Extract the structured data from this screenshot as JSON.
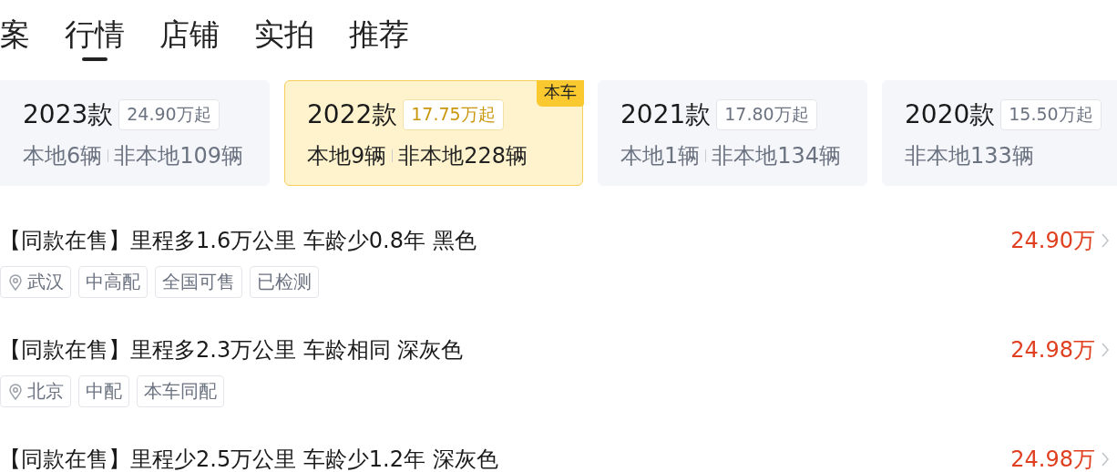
{
  "tabs": [
    {
      "label": "案",
      "selected": false
    },
    {
      "label": "行情",
      "selected": true
    },
    {
      "label": "店铺",
      "selected": false
    },
    {
      "label": "实拍",
      "selected": false
    },
    {
      "label": "推荐",
      "selected": false
    }
  ],
  "model_years": [
    {
      "year": "2023款",
      "price": "24.90万起",
      "counts": [
        "本地6辆",
        "非本地109辆"
      ],
      "selected": false
    },
    {
      "year": "2022款",
      "price": "17.75万起",
      "counts": [
        "本地9辆",
        "非本地228辆"
      ],
      "selected": true,
      "badge": "本车"
    },
    {
      "year": "2021款",
      "price": "17.80万起",
      "counts": [
        "本地1辆",
        "非本地134辆"
      ],
      "selected": false
    },
    {
      "year": "2020款",
      "price": "15.50万起",
      "counts": [
        "非本地133辆"
      ],
      "selected": false
    }
  ],
  "listings": [
    {
      "title": "【同款在售】里程多1.6万公里 车龄少0.8年 黑色",
      "price": "24.90万",
      "tags": [
        {
          "kind": "location",
          "text": "武汉"
        },
        {
          "kind": "plain",
          "text": "中高配"
        },
        {
          "kind": "plain",
          "text": "全国可售"
        },
        {
          "kind": "plain",
          "text": "已检测"
        }
      ]
    },
    {
      "title": "【同款在售】里程多2.3万公里 车龄相同 深灰色",
      "price": "24.98万",
      "tags": [
        {
          "kind": "location",
          "text": "北京"
        },
        {
          "kind": "plain",
          "text": "中配"
        },
        {
          "kind": "plain",
          "text": "本车同配"
        }
      ]
    },
    {
      "title": "【同款在售】里程少2.5万公里 车龄少1.2年 深灰色",
      "price": "24.98万"
    }
  ]
}
